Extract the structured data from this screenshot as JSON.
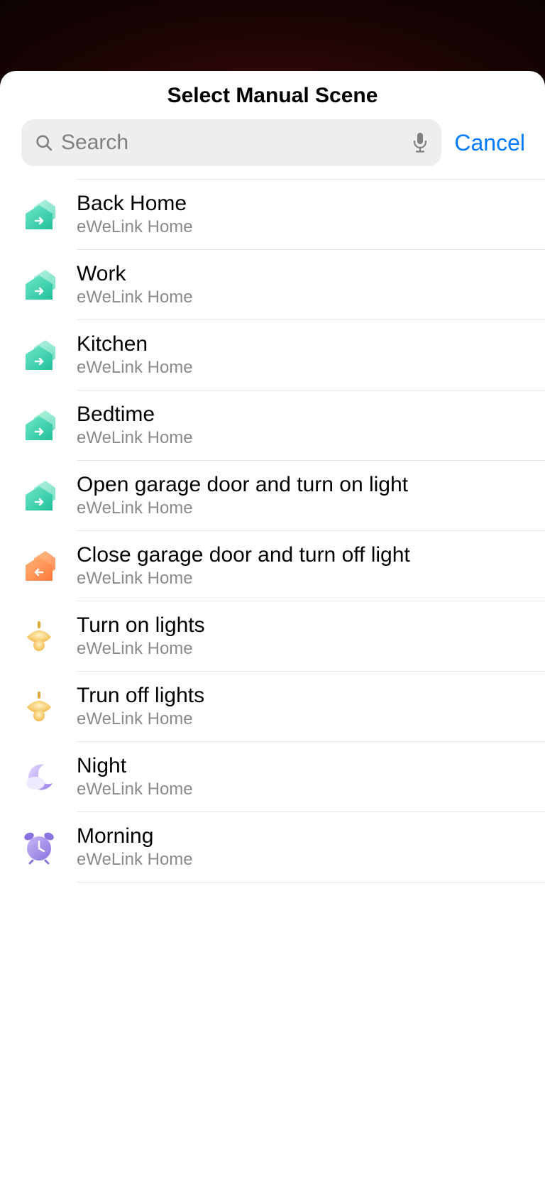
{
  "header": {
    "title": "Select Manual Scene"
  },
  "search": {
    "placeholder": "Search",
    "value": "",
    "cancel_label": "Cancel"
  },
  "scenes": [
    {
      "title": "Back Home",
      "subtitle": "eWeLink Home",
      "icon": "home-green"
    },
    {
      "title": "Work",
      "subtitle": "eWeLink Home",
      "icon": "home-green"
    },
    {
      "title": "Kitchen",
      "subtitle": "eWeLink Home",
      "icon": "home-green"
    },
    {
      "title": "Bedtime",
      "subtitle": "eWeLink Home",
      "icon": "home-green"
    },
    {
      "title": "Open garage door and turn on light",
      "subtitle": "eWeLink Home",
      "icon": "home-green"
    },
    {
      "title": "Close garage door and turn off light",
      "subtitle": "eWeLink Home",
      "icon": "home-orange"
    },
    {
      "title": "Turn on lights",
      "subtitle": "eWeLink Home",
      "icon": "lamp"
    },
    {
      "title": "Trun off lights",
      "subtitle": "eWeLink Home",
      "icon": "lamp"
    },
    {
      "title": "Night",
      "subtitle": "eWeLink Home",
      "icon": "moon"
    },
    {
      "title": "Morning",
      "subtitle": "eWeLink Home",
      "icon": "clock"
    }
  ]
}
